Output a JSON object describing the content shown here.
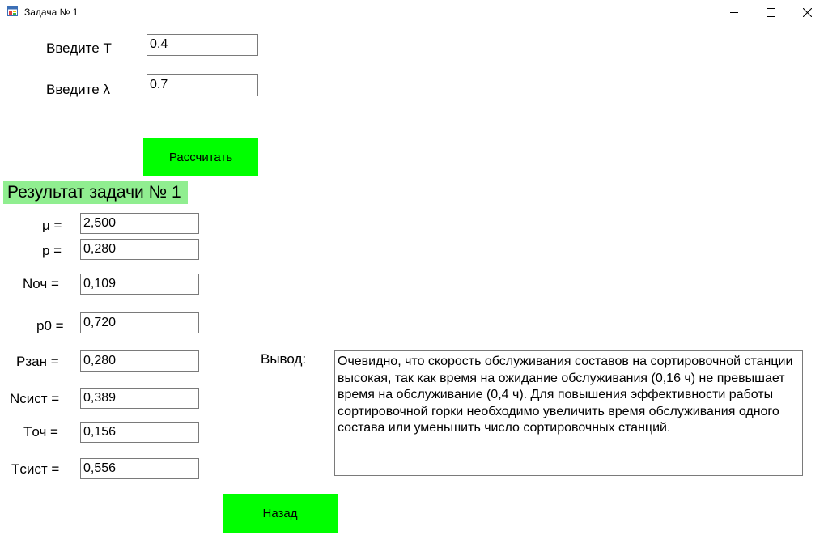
{
  "window": {
    "title": "Задача № 1",
    "icon": "app-form-icon",
    "controls": [
      "minimize-icon",
      "maximize-icon",
      "close-icon"
    ]
  },
  "inputs": {
    "t_label": "Введите T",
    "t_value": "0.4",
    "lambda_label": "Введите λ",
    "lambda_value": "0.7"
  },
  "calculate_button": "Рассчитать",
  "result_title": "Результат задачи № 1",
  "results": [
    {
      "label": "μ =",
      "value": "2,500"
    },
    {
      "label": "p =",
      "value": "0,280"
    },
    {
      "label": "Nоч =",
      "value": "0,109"
    },
    {
      "label": "p0 =",
      "value": "0,720"
    },
    {
      "label": "Pзан =",
      "value": "0,280"
    },
    {
      "label": "Nсист =",
      "value": "0,389"
    },
    {
      "label": "Tоч =",
      "value": "0,156"
    },
    {
      "label": "Tсист =",
      "value": "0,556"
    }
  ],
  "conclusion": {
    "label": "Вывод:",
    "text": "Очевидно, что скорость обслуживания составов на сортировочной станции высокая, так как время на ожидание обслуживания (0,16 ч) не превышает время на обслуживание (0,4 ч). Для повышения эффективности работы сортировочной горки необходимо увеличить время обслуживания одного состава или уменьшить число сортировочных станций."
  },
  "back_button": "Назад",
  "colors": {
    "button_green": "#00ff00",
    "result_title_bg": "#90ee90"
  }
}
